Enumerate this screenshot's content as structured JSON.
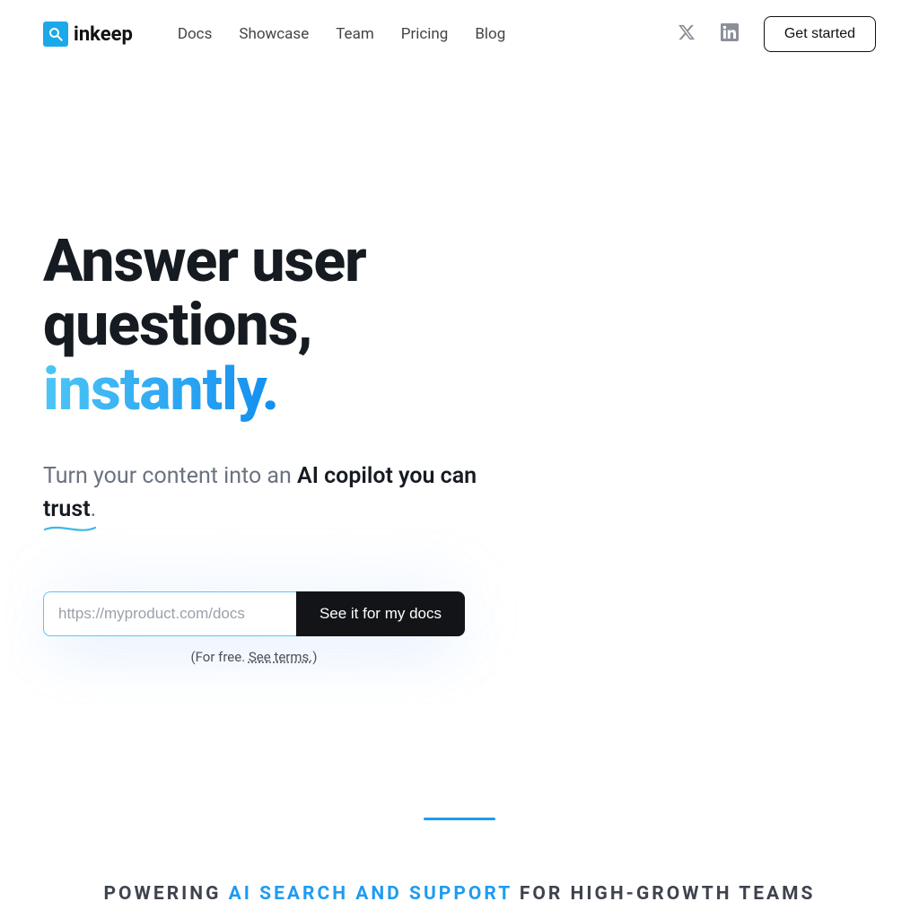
{
  "brand": {
    "name": "inkeep"
  },
  "nav": {
    "items": [
      "Docs",
      "Showcase",
      "Team",
      "Pricing",
      "Blog"
    ]
  },
  "header": {
    "get_started_label": "Get started"
  },
  "hero": {
    "title_line1": "Answer user",
    "title_line2": "questions,",
    "title_accent": "instantly.",
    "sub_prefix": "Turn your content into an ",
    "sub_strong_pre_trust": "AI copilot you can ",
    "sub_strong_trust": "trust",
    "sub_suffix": "."
  },
  "cta": {
    "placeholder": "https://myproduct.com/docs",
    "button_label": "See it for my docs",
    "terms_prefix": "(For free. ",
    "terms_link": "See terms.",
    "terms_suffix": ")"
  },
  "powering": {
    "prefix": "POWERING ",
    "accent": "AI SEARCH AND SUPPORT",
    "suffix": " FOR HIGH-GROWTH TEAMS"
  },
  "colors": {
    "accent": "#1F9BF0",
    "logo": "#1BA9E8",
    "text_dark": "#161a21"
  }
}
